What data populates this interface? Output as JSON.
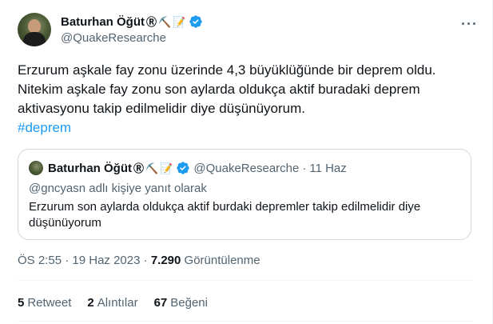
{
  "author": {
    "display_name": "Baturhan Öğüt",
    "name_emoji": "Ⓡ",
    "pick_emoji": "⛏️",
    "memo_emoji": "📝",
    "handle": "@QuakeResearche"
  },
  "more_icon": "···",
  "tweet": {
    "lines": [
      "Erzurum aşkale fay zonu üzerinde 4,3 büyüklüğünde bir deprem oldu.",
      "Nitekim aşkale fay zonu son aylarda oldukça aktif buradaki deprem",
      "aktivasyonu takip edilmelidir diye düşünüyorum."
    ],
    "hashtag": "#deprem"
  },
  "quote": {
    "display_name": "Baturhan Öğüt",
    "name_emoji": "Ⓡ",
    "pick_emoji": "⛏️",
    "memo_emoji": "📝",
    "handle": "@QuakeResearche",
    "separator": "·",
    "date": "11 Haz",
    "reply_to": "@gncyasn adlı kişiye yanıt olarak",
    "text": "Erzurum son aylarda oldukça aktif burdaki depremler takip edilmelidir diye düşünüyorum"
  },
  "meta": {
    "time": "ÖS 2:55",
    "separator": "·",
    "date": "19 Haz 2023",
    "views_count": "7.290",
    "views_label": "Görüntülenme"
  },
  "stats": {
    "retweets_count": "5",
    "retweets_label": "Retweet",
    "quotes_count": "2",
    "quotes_label": "Alıntılar",
    "likes_count": "67",
    "likes_label": "Beğeni"
  },
  "colors": {
    "link": "#1d9bf0",
    "secondary_text": "#536471",
    "primary_text": "#0f1419",
    "border": "#cfd9de",
    "divider": "#eff3f4"
  }
}
